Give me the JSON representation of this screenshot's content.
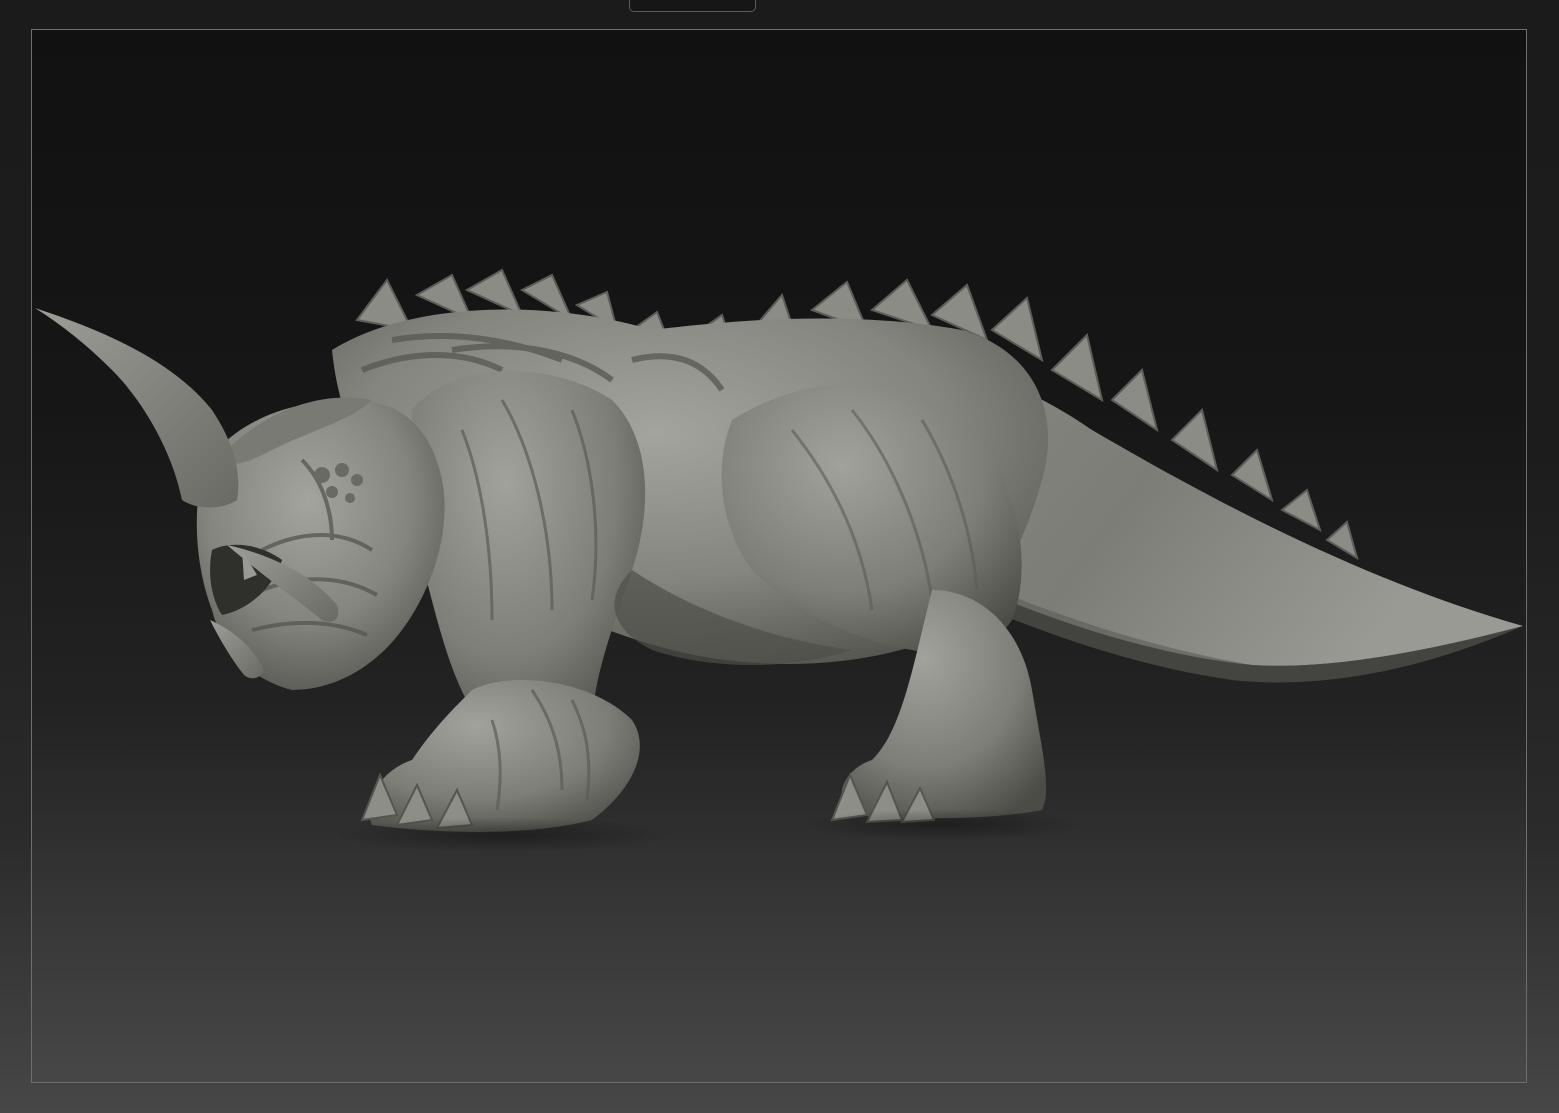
{
  "app": {
    "view": "3d-viewport",
    "subject": "creature-sculpt"
  },
  "icons": {
    "top_tab": "viewport-tab-handle"
  },
  "colors": {
    "background_top": "#1b1b1b",
    "background_bottom": "#474747",
    "viewport_border": "#6e6e6e",
    "model_clay": "#8a8a84",
    "model_shadow": "#55554f",
    "model_highlight": "#aeaea8"
  }
}
